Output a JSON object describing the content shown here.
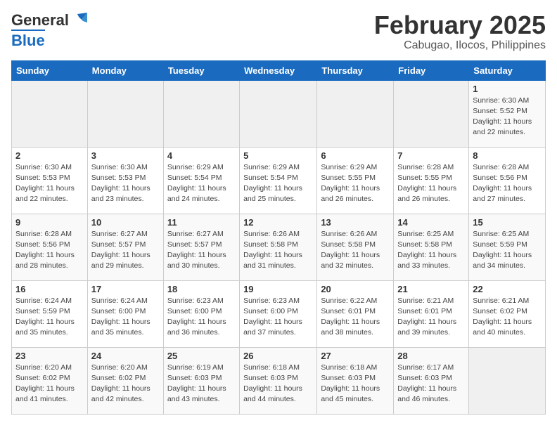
{
  "header": {
    "logo_general": "General",
    "logo_blue": "Blue",
    "title": "February 2025",
    "subtitle": "Cabugao, Ilocos, Philippines"
  },
  "weekdays": [
    "Sunday",
    "Monday",
    "Tuesday",
    "Wednesday",
    "Thursday",
    "Friday",
    "Saturday"
  ],
  "weeks": [
    [
      {
        "day": "",
        "info": ""
      },
      {
        "day": "",
        "info": ""
      },
      {
        "day": "",
        "info": ""
      },
      {
        "day": "",
        "info": ""
      },
      {
        "day": "",
        "info": ""
      },
      {
        "day": "",
        "info": ""
      },
      {
        "day": "1",
        "info": "Sunrise: 6:30 AM\nSunset: 5:52 PM\nDaylight: 11 hours\nand 22 minutes."
      }
    ],
    [
      {
        "day": "2",
        "info": "Sunrise: 6:30 AM\nSunset: 5:53 PM\nDaylight: 11 hours\nand 22 minutes."
      },
      {
        "day": "3",
        "info": "Sunrise: 6:30 AM\nSunset: 5:53 PM\nDaylight: 11 hours\nand 23 minutes."
      },
      {
        "day": "4",
        "info": "Sunrise: 6:29 AM\nSunset: 5:54 PM\nDaylight: 11 hours\nand 24 minutes."
      },
      {
        "day": "5",
        "info": "Sunrise: 6:29 AM\nSunset: 5:54 PM\nDaylight: 11 hours\nand 25 minutes."
      },
      {
        "day": "6",
        "info": "Sunrise: 6:29 AM\nSunset: 5:55 PM\nDaylight: 11 hours\nand 26 minutes."
      },
      {
        "day": "7",
        "info": "Sunrise: 6:28 AM\nSunset: 5:55 PM\nDaylight: 11 hours\nand 26 minutes."
      },
      {
        "day": "8",
        "info": "Sunrise: 6:28 AM\nSunset: 5:56 PM\nDaylight: 11 hours\nand 27 minutes."
      }
    ],
    [
      {
        "day": "9",
        "info": "Sunrise: 6:28 AM\nSunset: 5:56 PM\nDaylight: 11 hours\nand 28 minutes."
      },
      {
        "day": "10",
        "info": "Sunrise: 6:27 AM\nSunset: 5:57 PM\nDaylight: 11 hours\nand 29 minutes."
      },
      {
        "day": "11",
        "info": "Sunrise: 6:27 AM\nSunset: 5:57 PM\nDaylight: 11 hours\nand 30 minutes."
      },
      {
        "day": "12",
        "info": "Sunrise: 6:26 AM\nSunset: 5:58 PM\nDaylight: 11 hours\nand 31 minutes."
      },
      {
        "day": "13",
        "info": "Sunrise: 6:26 AM\nSunset: 5:58 PM\nDaylight: 11 hours\nand 32 minutes."
      },
      {
        "day": "14",
        "info": "Sunrise: 6:25 AM\nSunset: 5:58 PM\nDaylight: 11 hours\nand 33 minutes."
      },
      {
        "day": "15",
        "info": "Sunrise: 6:25 AM\nSunset: 5:59 PM\nDaylight: 11 hours\nand 34 minutes."
      }
    ],
    [
      {
        "day": "16",
        "info": "Sunrise: 6:24 AM\nSunset: 5:59 PM\nDaylight: 11 hours\nand 35 minutes."
      },
      {
        "day": "17",
        "info": "Sunrise: 6:24 AM\nSunset: 6:00 PM\nDaylight: 11 hours\nand 35 minutes."
      },
      {
        "day": "18",
        "info": "Sunrise: 6:23 AM\nSunset: 6:00 PM\nDaylight: 11 hours\nand 36 minutes."
      },
      {
        "day": "19",
        "info": "Sunrise: 6:23 AM\nSunset: 6:00 PM\nDaylight: 11 hours\nand 37 minutes."
      },
      {
        "day": "20",
        "info": "Sunrise: 6:22 AM\nSunset: 6:01 PM\nDaylight: 11 hours\nand 38 minutes."
      },
      {
        "day": "21",
        "info": "Sunrise: 6:21 AM\nSunset: 6:01 PM\nDaylight: 11 hours\nand 39 minutes."
      },
      {
        "day": "22",
        "info": "Sunrise: 6:21 AM\nSunset: 6:02 PM\nDaylight: 11 hours\nand 40 minutes."
      }
    ],
    [
      {
        "day": "23",
        "info": "Sunrise: 6:20 AM\nSunset: 6:02 PM\nDaylight: 11 hours\nand 41 minutes."
      },
      {
        "day": "24",
        "info": "Sunrise: 6:20 AM\nSunset: 6:02 PM\nDaylight: 11 hours\nand 42 minutes."
      },
      {
        "day": "25",
        "info": "Sunrise: 6:19 AM\nSunset: 6:03 PM\nDaylight: 11 hours\nand 43 minutes."
      },
      {
        "day": "26",
        "info": "Sunrise: 6:18 AM\nSunset: 6:03 PM\nDaylight: 11 hours\nand 44 minutes."
      },
      {
        "day": "27",
        "info": "Sunrise: 6:18 AM\nSunset: 6:03 PM\nDaylight: 11 hours\nand 45 minutes."
      },
      {
        "day": "28",
        "info": "Sunrise: 6:17 AM\nSunset: 6:03 PM\nDaylight: 11 hours\nand 46 minutes."
      },
      {
        "day": "",
        "info": ""
      }
    ]
  ]
}
